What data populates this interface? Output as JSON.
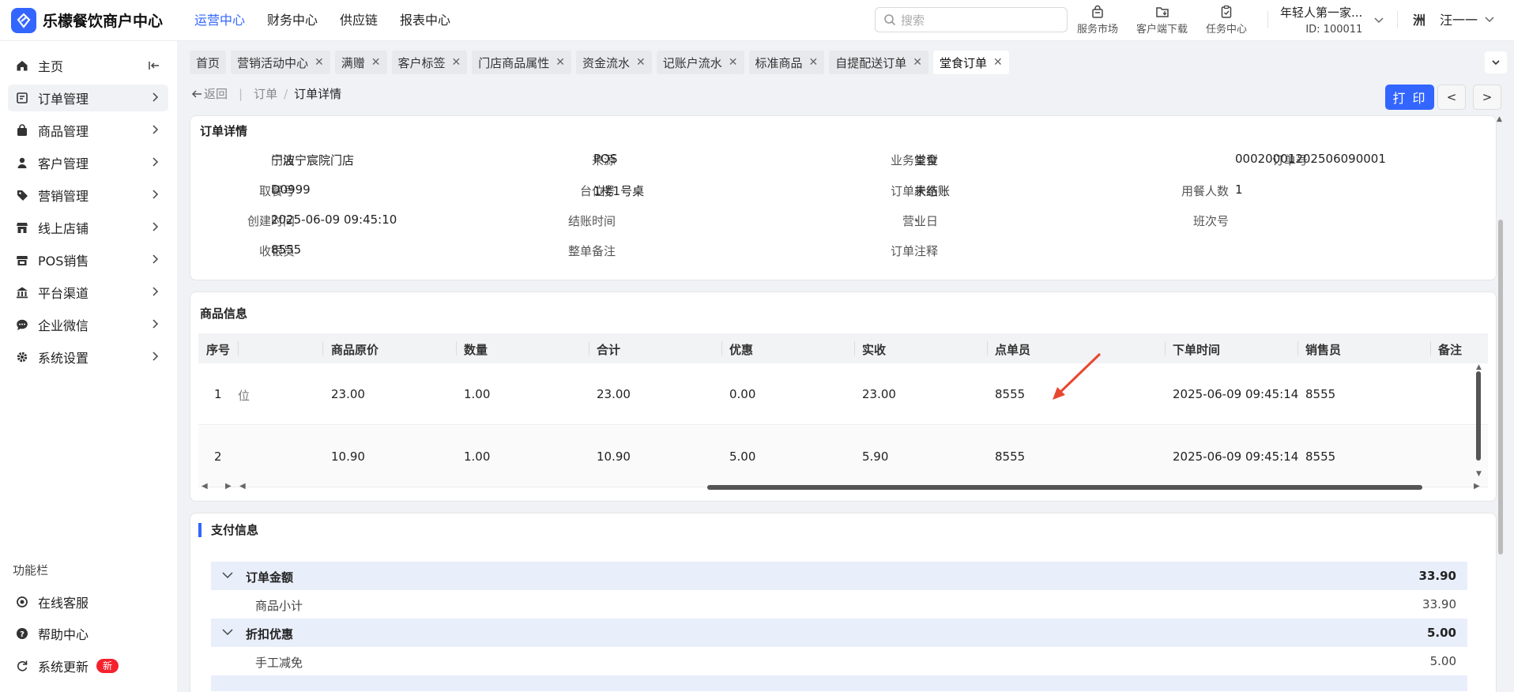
{
  "app": {
    "title": "乐檬餐饮商户中心",
    "accent": "#3366ff"
  },
  "topnav": [
    {
      "label": "运营中心",
      "active": true
    },
    {
      "label": "财务中心"
    },
    {
      "label": "供应链"
    },
    {
      "label": "报表中心"
    }
  ],
  "search": {
    "placeholder": "搜索"
  },
  "tools": [
    {
      "label": "服务市场",
      "icon": "shopping-bag-icon"
    },
    {
      "label": "客户端下载",
      "icon": "download-folder-icon"
    },
    {
      "label": "任务中心",
      "icon": "clipboard-check-icon"
    }
  ],
  "account": {
    "name": "年轻人第一家...",
    "id": "ID: 100011"
  },
  "user": {
    "name": "汪一一",
    "avatar": "洲"
  },
  "sidebar": {
    "items": [
      {
        "label": "主页",
        "icon": "home-icon"
      },
      {
        "label": "订单管理",
        "icon": "order-icon",
        "active": true
      },
      {
        "label": "商品管理",
        "icon": "goods-bag-icon"
      },
      {
        "label": "客户管理",
        "icon": "person-icon"
      },
      {
        "label": "营销管理",
        "icon": "tag-icon"
      },
      {
        "label": "线上店铺",
        "icon": "store-icon"
      },
      {
        "label": "POS销售",
        "icon": "pos-store-icon"
      },
      {
        "label": "平台渠道",
        "icon": "bank-icon"
      },
      {
        "label": "企业微信",
        "icon": "chat-icon"
      },
      {
        "label": "系统设置",
        "icon": "gear-icon"
      }
    ],
    "func_title": "功能栏",
    "func_items": [
      {
        "label": "在线客服",
        "icon": "headset-icon"
      },
      {
        "label": "帮助中心",
        "icon": "help-icon"
      },
      {
        "label": "系统更新",
        "icon": "refresh-icon",
        "badge": "新"
      }
    ]
  },
  "tabs": [
    {
      "label": "首页",
      "closable": false
    },
    {
      "label": "营销活动中心",
      "closable": true
    },
    {
      "label": "满赠",
      "closable": true
    },
    {
      "label": "客户标签",
      "closable": true
    },
    {
      "label": "门店商品属性",
      "closable": true
    },
    {
      "label": "资金流水",
      "closable": true
    },
    {
      "label": "记账户流水",
      "closable": true
    },
    {
      "label": "标准商品",
      "closable": true
    },
    {
      "label": "自提配送订单",
      "closable": true
    },
    {
      "label": "堂食订单",
      "closable": true,
      "active": true
    }
  ],
  "breadcrumb": {
    "back": "返回",
    "parent": "订单",
    "current": "订单详情"
  },
  "actions": {
    "print": "打 印",
    "prev": "<",
    "next": ">"
  },
  "order_detail": {
    "title": "订单详情",
    "fields": [
      {
        "label": "门店",
        "value": "宁波宁宸院门店"
      },
      {
        "label": "来源",
        "value": "POS"
      },
      {
        "label": "业务类型",
        "value": "堂食"
      },
      {
        "label": "订单号",
        "value": "00020001202506090001"
      },
      {
        "label": "取餐号",
        "value": "D0999"
      },
      {
        "label": "台位号",
        "value": "1楼1号桌"
      },
      {
        "label": "订单状态",
        "value": "未结账"
      },
      {
        "label": "用餐人数",
        "value": "1"
      },
      {
        "label": "创建时间",
        "value": "2025-06-09 09:45:10"
      },
      {
        "label": "结账时间",
        "value": ""
      },
      {
        "label": "营业日",
        "value": "-"
      },
      {
        "label": "班次号",
        "value": ""
      },
      {
        "label": "收银员",
        "value": "8555"
      },
      {
        "label": "整单备注",
        "value": ""
      },
      {
        "label": "订单注释",
        "value": ""
      }
    ]
  },
  "goods": {
    "title": "商品信息",
    "columns": [
      "序号",
      "商品原价",
      "数量",
      "合计",
      "优惠",
      "实收",
      "点单员",
      "下单时间",
      "销售员",
      "备注"
    ],
    "rows": [
      {
        "cells": [
          "1",
          "23.00",
          "1.00",
          "23.00",
          "0.00",
          "23.00",
          "8555",
          "2025-06-09 09:45:14",
          "8555",
          ""
        ],
        "clipped": "位"
      },
      {
        "cells": [
          "2",
          "10.90",
          "1.00",
          "10.90",
          "5.00",
          "5.90",
          "8555",
          "2025-06-09 09:45:14",
          "8555",
          ""
        ],
        "clipped": ""
      }
    ]
  },
  "payment": {
    "title": "支付信息",
    "groups": [
      {
        "label": "订单金额",
        "amount": "33.90",
        "children": [
          {
            "label": "商品小计",
            "amount": "33.90"
          }
        ]
      },
      {
        "label": "折扣优惠",
        "amount": "5.00",
        "children": [
          {
            "label": "手工减免",
            "amount": "5.00"
          }
        ]
      }
    ]
  },
  "colors": {
    "annotation_arrow": "#e8472f",
    "badge": "#f5222d",
    "group_bg": "#e9eefb"
  }
}
